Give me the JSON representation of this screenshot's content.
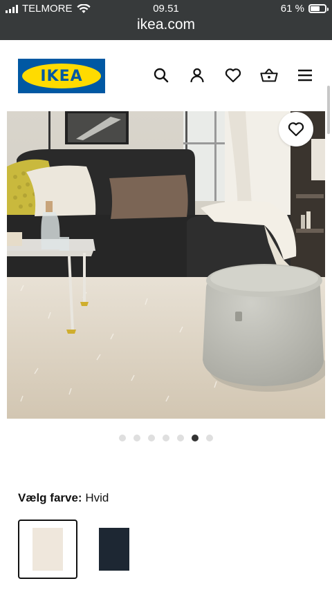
{
  "status_bar": {
    "carrier": "TELMORE",
    "time": "09.51",
    "battery": "61 %",
    "battery_level": 0.61,
    "url": "ikea.com"
  },
  "header": {
    "logo_text": "IKEA",
    "icons": [
      "search-icon",
      "account-icon",
      "favourites-icon",
      "basket-icon",
      "menu-icon"
    ]
  },
  "hero": {
    "favourite_icon": "heart-icon"
  },
  "carousel": {
    "count": 7,
    "active_index": 5
  },
  "color_select": {
    "label": "Vælg farve:",
    "value": "Hvid",
    "swatches": [
      {
        "color": "#efe7dc",
        "selected": true
      },
      {
        "color": "#1d2733",
        "selected": false
      }
    ]
  },
  "colors": {
    "brand_blue": "#0058a3",
    "brand_yellow": "#ffdb00",
    "status_bar": "#373a3b"
  }
}
